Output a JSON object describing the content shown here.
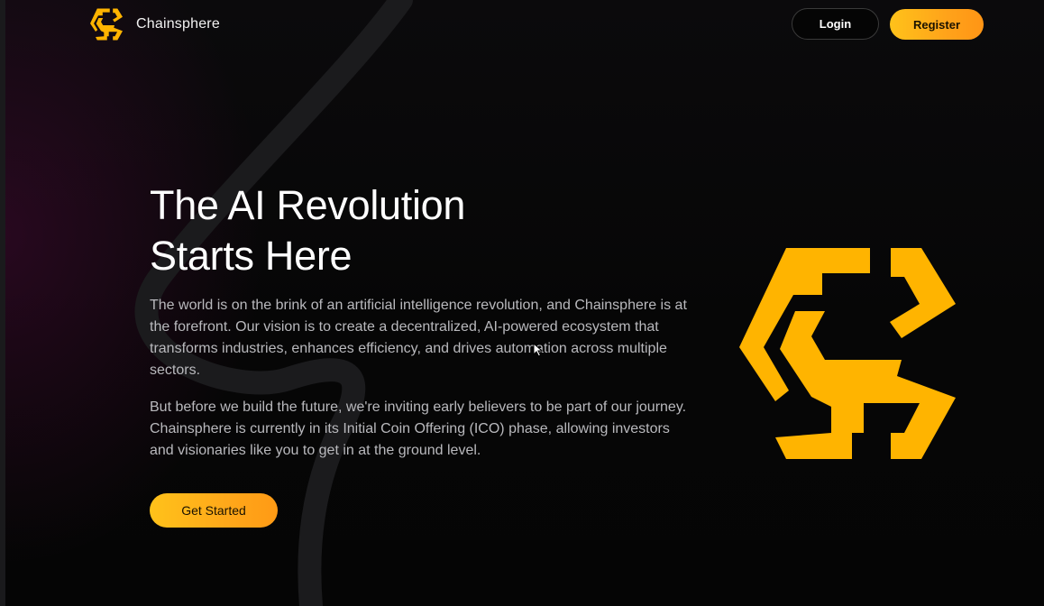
{
  "header": {
    "brand_name": "Chainsphere",
    "login_label": "Login",
    "register_label": "Register"
  },
  "hero": {
    "title_line1": "The AI Revolution",
    "title_line2": "Starts Here",
    "paragraph1": "The world is on the brink of an artificial intelligence revolution, and Chainsphere is at the forefront. Our vision is to create a decentralized, AI-powered ecosystem that transforms industries, enhances efficiency, and drives automation across multiple sectors.",
    "paragraph2": "But before we build the future, we're inviting early believers to be part of our journey. Chainsphere is currently in its Initial Coin Offering (ICO) phase, allowing investors and visionaries like you to get in at the ground level.",
    "cta_label": "Get Started"
  },
  "colors": {
    "accent": "#ffb400",
    "accent_gradient_end": "#ff9515",
    "background": "#050505",
    "text": "#ffffff",
    "muted_text": "#b9b9bd"
  },
  "icons": {
    "brand_logo": "chainsphere-logo-icon",
    "hero_logo": "chainsphere-logo-icon",
    "cursor": "mouse-cursor-icon"
  }
}
